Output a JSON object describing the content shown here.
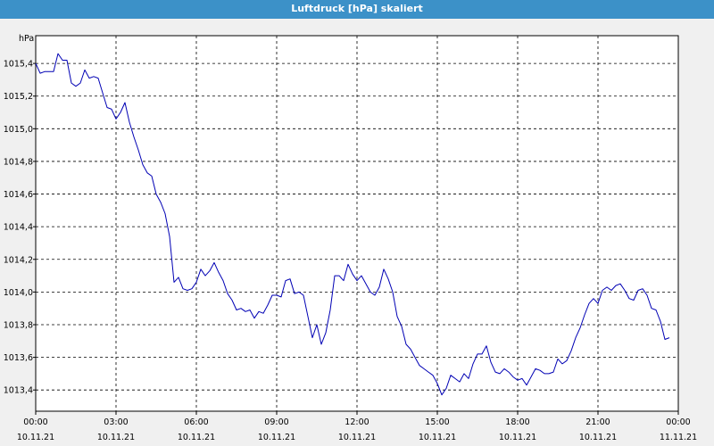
{
  "window": {
    "title": "Luftdruck [hPa] skaliert"
  },
  "colors": {
    "title_bar": "#3c91c8",
    "series": "#0000b4",
    "plot_background": "#ffffff",
    "grid": "#000000"
  },
  "chart_data": {
    "type": "line",
    "title": "Luftdruck [hPa] skaliert",
    "ylabel": "hPa",
    "xlabel": "",
    "grid": true,
    "ylim": [
      1013.27,
      1015.57
    ],
    "xlim": [
      "2021-11-10 00:00",
      "2021-11-11 00:00"
    ],
    "yticks": [
      "1013,4",
      "1013,6",
      "1013,8",
      "1014,0",
      "1014,2",
      "1014,4",
      "1014,6",
      "1014,8",
      "1015,0",
      "1015,2",
      "1015,4"
    ],
    "xticks": [
      {
        "time": "00:00",
        "date": "10.11.21"
      },
      {
        "time": "03:00",
        "date": "10.11.21"
      },
      {
        "time": "06:00",
        "date": "10.11.21"
      },
      {
        "time": "09:00",
        "date": "10.11.21"
      },
      {
        "time": "12:00",
        "date": "10.11.21"
      },
      {
        "time": "15:00",
        "date": "10.11.21"
      },
      {
        "time": "18:00",
        "date": "10.11.21"
      },
      {
        "time": "21:00",
        "date": "10.11.21"
      },
      {
        "time": "00:00",
        "date": "11.11.21"
      }
    ],
    "series": [
      {
        "points": [
          [
            "00:00",
            1015.4
          ],
          [
            "00:10",
            1015.34
          ],
          [
            "00:20",
            1015.35
          ],
          [
            "00:40",
            1015.35
          ],
          [
            "00:50",
            1015.46
          ],
          [
            "01:00",
            1015.42
          ],
          [
            "01:10",
            1015.42
          ],
          [
            "01:20",
            1015.28
          ],
          [
            "01:30",
            1015.26
          ],
          [
            "01:40",
            1015.28
          ],
          [
            "01:50",
            1015.36
          ],
          [
            "02:00",
            1015.31
          ],
          [
            "02:10",
            1015.32
          ],
          [
            "02:20",
            1015.31
          ],
          [
            "02:30",
            1015.22
          ],
          [
            "02:40",
            1015.13
          ],
          [
            "02:50",
            1015.12
          ],
          [
            "03:00",
            1015.06
          ],
          [
            "03:10",
            1015.1
          ],
          [
            "03:20",
            1015.16
          ],
          [
            "03:30",
            1015.04
          ],
          [
            "03:40",
            1014.95
          ],
          [
            "03:50",
            1014.87
          ],
          [
            "04:00",
            1014.78
          ],
          [
            "04:10",
            1014.73
          ],
          [
            "04:20",
            1014.71
          ],
          [
            "04:30",
            1014.6
          ],
          [
            "04:40",
            1014.55
          ],
          [
            "04:50",
            1014.48
          ],
          [
            "05:00",
            1014.34
          ],
          [
            "05:10",
            1014.06
          ],
          [
            "05:20",
            1014.09
          ],
          [
            "05:30",
            1014.02
          ],
          [
            "05:40",
            1014.01
          ],
          [
            "05:50",
            1014.02
          ],
          [
            "06:00",
            1014.06
          ],
          [
            "06:10",
            1014.14
          ],
          [
            "06:20",
            1014.1
          ],
          [
            "06:30",
            1014.13
          ],
          [
            "06:40",
            1014.18
          ],
          [
            "06:50",
            1014.12
          ],
          [
            "07:00",
            1014.07
          ],
          [
            "07:10",
            1013.99
          ],
          [
            "07:20",
            1013.95
          ],
          [
            "07:30",
            1013.89
          ],
          [
            "07:40",
            1013.9
          ],
          [
            "07:50",
            1013.88
          ],
          [
            "08:00",
            1013.89
          ],
          [
            "08:10",
            1013.84
          ],
          [
            "08:20",
            1013.88
          ],
          [
            "08:30",
            1013.87
          ],
          [
            "08:40",
            1013.92
          ],
          [
            "08:50",
            1013.98
          ],
          [
            "09:00",
            1013.98
          ],
          [
            "09:10",
            1013.97
          ],
          [
            "09:20",
            1014.07
          ],
          [
            "09:30",
            1014.08
          ],
          [
            "09:40",
            1013.99
          ],
          [
            "09:50",
            1014.0
          ],
          [
            "10:00",
            1013.98
          ],
          [
            "10:10",
            1013.85
          ],
          [
            "10:20",
            1013.72
          ],
          [
            "10:30",
            1013.8
          ],
          [
            "10:40",
            1013.68
          ],
          [
            "10:50",
            1013.75
          ],
          [
            "11:00",
            1013.89
          ],
          [
            "11:10",
            1014.1
          ],
          [
            "11:20",
            1014.1
          ],
          [
            "11:30",
            1014.07
          ],
          [
            "11:40",
            1014.17
          ],
          [
            "11:50",
            1014.11
          ],
          [
            "12:00",
            1014.07
          ],
          [
            "12:10",
            1014.1
          ],
          [
            "12:20",
            1014.05
          ],
          [
            "12:30",
            1014.0
          ],
          [
            "12:40",
            1013.98
          ],
          [
            "12:50",
            1014.03
          ],
          [
            "13:00",
            1014.14
          ],
          [
            "13:10",
            1014.08
          ],
          [
            "13:20",
            1014.0
          ],
          [
            "13:30",
            1013.85
          ],
          [
            "13:40",
            1013.79
          ],
          [
            "13:50",
            1013.68
          ],
          [
            "14:00",
            1013.65
          ],
          [
            "14:10",
            1013.6
          ],
          [
            "14:20",
            1013.55
          ],
          [
            "14:30",
            1013.53
          ],
          [
            "14:40",
            1013.51
          ],
          [
            "14:50",
            1013.49
          ],
          [
            "15:00",
            1013.44
          ],
          [
            "15:10",
            1013.37
          ],
          [
            "15:20",
            1013.41
          ],
          [
            "15:30",
            1013.49
          ],
          [
            "15:40",
            1013.47
          ],
          [
            "15:50",
            1013.45
          ],
          [
            "16:00",
            1013.5
          ],
          [
            "16:10",
            1013.47
          ],
          [
            "16:20",
            1013.56
          ],
          [
            "16:30",
            1013.62
          ],
          [
            "16:40",
            1013.62
          ],
          [
            "16:50",
            1013.67
          ],
          [
            "17:00",
            1013.57
          ],
          [
            "17:10",
            1013.51
          ],
          [
            "17:20",
            1013.5
          ],
          [
            "17:30",
            1013.53
          ],
          [
            "17:40",
            1013.51
          ],
          [
            "17:50",
            1013.48
          ],
          [
            "18:00",
            1013.46
          ],
          [
            "18:10",
            1013.47
          ],
          [
            "18:20",
            1013.43
          ],
          [
            "18:30",
            1013.48
          ],
          [
            "18:40",
            1013.53
          ],
          [
            "18:50",
            1013.52
          ],
          [
            "19:00",
            1013.5
          ],
          [
            "19:10",
            1013.5
          ],
          [
            "19:20",
            1013.51
          ],
          [
            "19:30",
            1013.59
          ],
          [
            "19:40",
            1013.56
          ],
          [
            "19:50",
            1013.58
          ],
          [
            "20:00",
            1013.64
          ],
          [
            "20:10",
            1013.72
          ],
          [
            "20:20",
            1013.78
          ],
          [
            "20:30",
            1013.86
          ],
          [
            "20:40",
            1013.93
          ],
          [
            "20:50",
            1013.96
          ],
          [
            "21:00",
            1013.93
          ],
          [
            "21:10",
            1014.01
          ],
          [
            "21:20",
            1014.03
          ],
          [
            "21:30",
            1014.01
          ],
          [
            "21:40",
            1014.04
          ],
          [
            "21:50",
            1014.05
          ],
          [
            "22:00",
            1014.01
          ],
          [
            "22:10",
            1013.96
          ],
          [
            "22:20",
            1013.95
          ],
          [
            "22:30",
            1014.01
          ],
          [
            "22:40",
            1014.02
          ],
          [
            "22:50",
            1013.98
          ],
          [
            "23:00",
            1013.9
          ],
          [
            "23:10",
            1013.89
          ],
          [
            "23:20",
            1013.82
          ],
          [
            "23:30",
            1013.71
          ],
          [
            "23:40",
            1013.72
          ]
        ]
      }
    ]
  }
}
